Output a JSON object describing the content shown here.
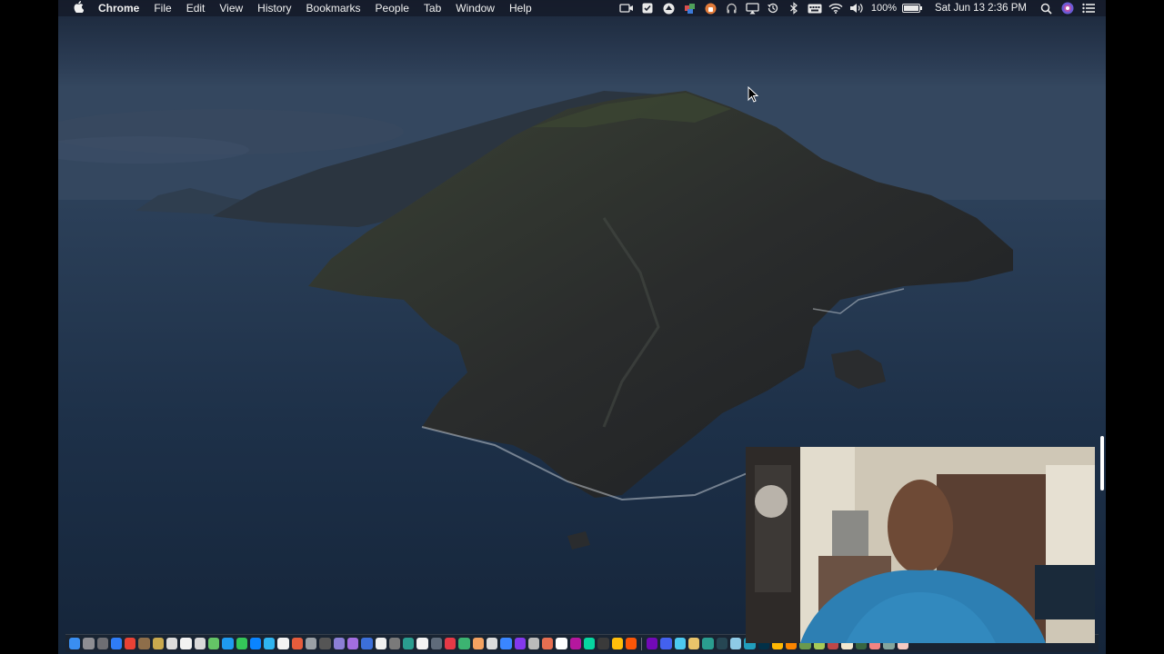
{
  "menubar": {
    "apple_icon": "apple-icon",
    "app_name": "Chrome",
    "menus": [
      "File",
      "Edit",
      "View",
      "History",
      "Bookmarks",
      "People",
      "Tab",
      "Window",
      "Help"
    ],
    "tray_icons": [
      "screen-recorder-icon",
      "checkbox-icon",
      "drive-icon",
      "puzzle-icon",
      "vpn-icon",
      "headphones-icon",
      "airplay-icon",
      "time-machine-icon",
      "bluetooth-icon",
      "keyboard-icon",
      "wifi-icon",
      "volume-icon"
    ],
    "battery_percent": "100%",
    "battery_level": 1.0,
    "clock": "Sat Jun 13  2:36 PM",
    "search_icon": "spotlight-icon",
    "siri_icon": "siri-icon",
    "notifications_icon": "notification-center-icon"
  },
  "desktop": {
    "wallpaper": "macOS Catalina island night"
  },
  "dock": {
    "icons": [
      "#3a8ef0",
      "#8e8e93",
      "#6e6e73",
      "#2f7cf6",
      "#e94235",
      "#8e6e4a",
      "#c9a94e",
      "#dcdcdc",
      "#f2f2f2",
      "#d9d9d9",
      "#64c466",
      "#1f9bf0",
      "#34c759",
      "#0a84ff",
      "#2fb4f0",
      "#f2f2f2",
      "#e65c3c",
      "#9aa0a6",
      "#555555",
      "#8b7fd6",
      "#a36ee0",
      "#3c6fd9",
      "#f0f0f0",
      "#7a7a7a",
      "#2a9d8f",
      "#f2f2f2",
      "#5f6b7a",
      "#e63946",
      "#3cb371",
      "#f4a261",
      "#dddddd",
      "#3a86ff",
      "#8338ec",
      "#bbbbbb",
      "#e76f51",
      "#ffffff",
      "#b5179e",
      "#06d6a0",
      "#3a3a3a",
      "#ffbe0b",
      "#fb5607",
      "#7209b7",
      "#4361ee",
      "#4cc9f0",
      "#e9c46a",
      "#2a9d8f",
      "#264653",
      "#8ecae6",
      "#219ebc",
      "#023047",
      "#ffb703",
      "#fb8500",
      "#6a994e",
      "#a7c957",
      "#bc4749",
      "#f2e8cf",
      "#386641",
      "#f28482",
      "#84a59d",
      "#f5cac3"
    ]
  },
  "colors": {
    "menubar_bg": "#141a28",
    "sky_top": "#1c2a3e",
    "sea": "#1b2e46"
  }
}
